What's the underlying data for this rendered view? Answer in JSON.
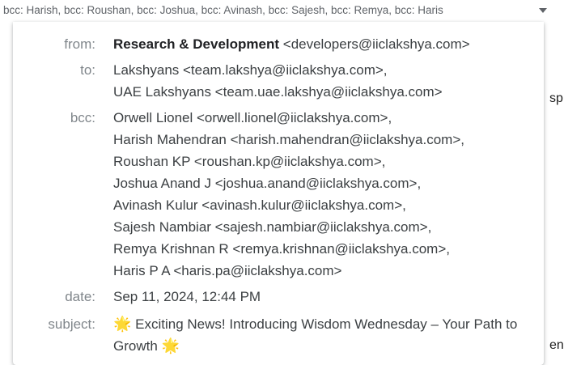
{
  "summary": {
    "text": "bcc: Harish, bcc: Roushan, bcc: Joshua, bcc: Avinash, bcc: Sajesh, bcc: Remya, bcc: Haris"
  },
  "background": {
    "fragment_1": "sp",
    "fragment_2": "en"
  },
  "details": {
    "from_label": "from:",
    "from_name": "Research & Development",
    "from_email": "<developers@iiclakshya.com>",
    "to_label": "to:",
    "to": [
      "Lakshyans <team.lakshya@iiclakshya.com>,",
      "UAE Lakshyans <team.uae.lakshya@iiclakshya.com>"
    ],
    "bcc_label": "bcc:",
    "bcc": [
      "Orwell Lionel <orwell.lionel@iiclakshya.com>,",
      "Harish Mahendran <harish.mahendran@iiclakshya.com>,",
      "Roushan KP <roushan.kp@iiclakshya.com>,",
      "Joshua Anand J <joshua.anand@iiclakshya.com>,",
      "Avinash Kulur <avinash.kulur@iiclakshya.com>,",
      "Sajesh Nambiar <sajesh.nambiar@iiclakshya.com>,",
      "Remya Krishnan R <remya.krishnan@iiclakshya.com>,",
      "Haris P A <haris.pa@iiclakshya.com>"
    ],
    "date_label": "date:",
    "date": "Sep 11, 2024, 12:44 PM",
    "subject_label": "subject:",
    "subject_star_left": "🌟",
    "subject_text": "Exciting News! Introducing Wisdom Wednesday – Your Path to Growth",
    "subject_star_right": "🌟"
  },
  "icons": {
    "dropdown": "chevron-down-icon",
    "star": "glowing-star-icon"
  },
  "colors": {
    "label": "#80868b",
    "value": "#3c4043",
    "star": "#f9ab00"
  }
}
